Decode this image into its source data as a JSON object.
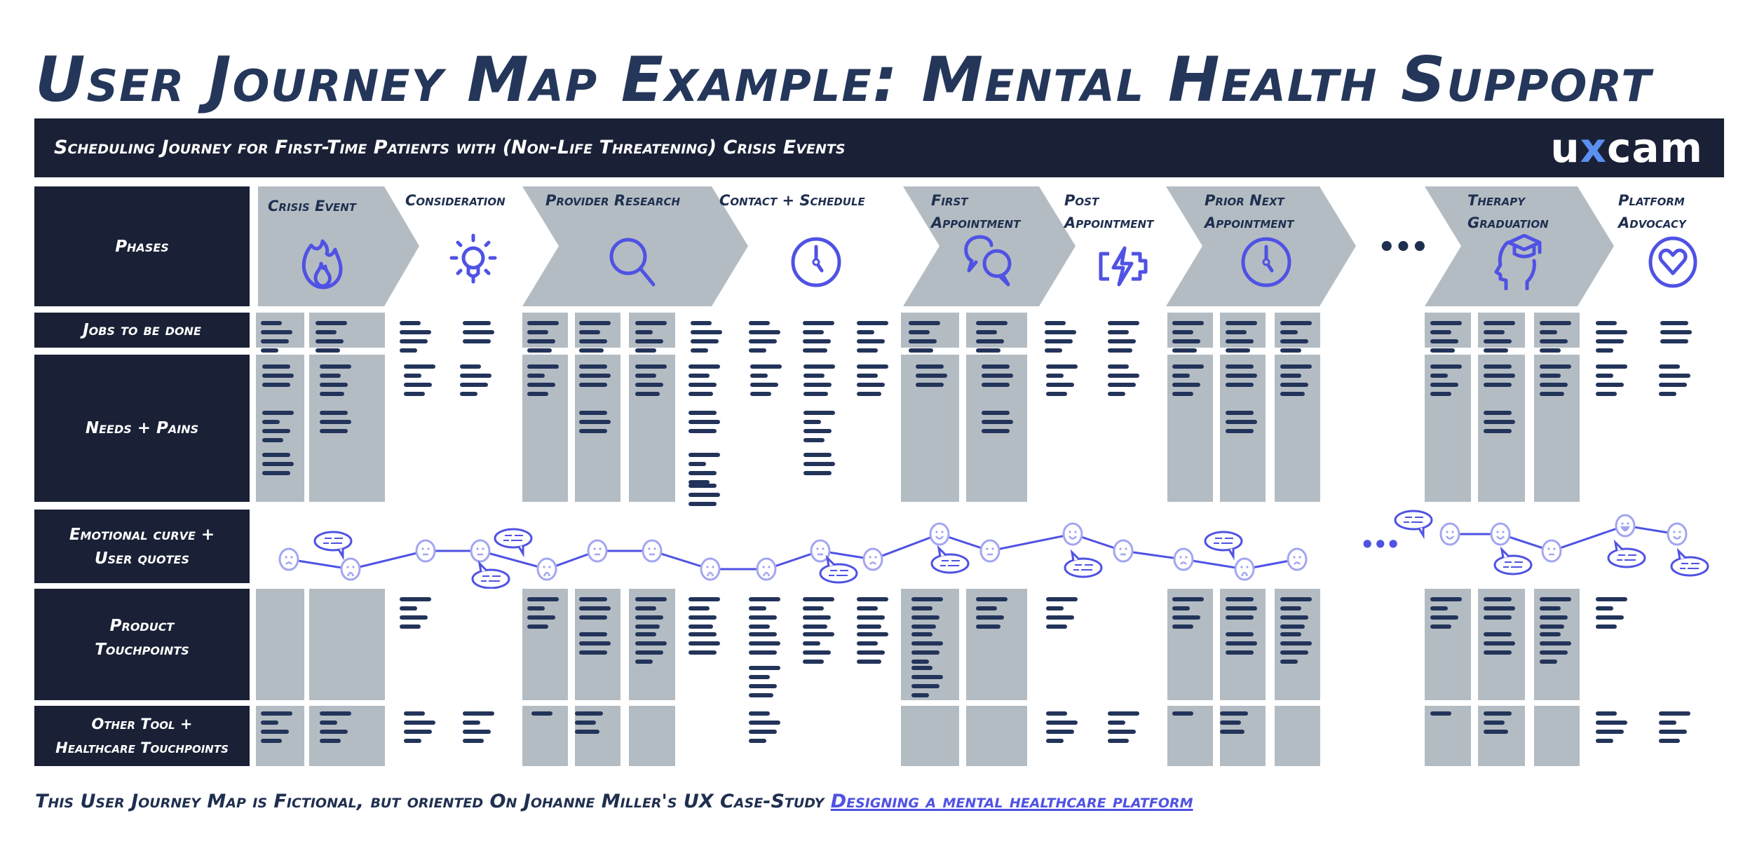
{
  "title": "User Journey Map Example: Mental Health Support",
  "banner": {
    "subtitle": "Scheduling Journey for First-Time Patients with (Non-Life Threatening) Crisis Events",
    "logo_prefix": "u",
    "logo_x": "x",
    "logo_suffix": "cam"
  },
  "row_labels": {
    "phases": "Phases",
    "jobs": "Jobs to be done",
    "needs": "Needs + Pains",
    "emotional_1": "Emotional curve +",
    "emotional_2": "User quotes",
    "product_1": "Product",
    "product_2": "Touchpoints",
    "other_1": "Other Tool +",
    "other_2": "Healthcare Touchpoints"
  },
  "phases": [
    {
      "label_1": "Crisis Event",
      "label_2": "",
      "icon": "flame-icon",
      "highlighted": true
    },
    {
      "label_1": "Consideration",
      "label_2": "",
      "icon": "lightbulb-icon",
      "highlighted": false
    },
    {
      "label_1": "Provider Research",
      "label_2": "",
      "icon": "search-icon",
      "highlighted": true
    },
    {
      "label_1": "Contact + Schedule",
      "label_2": "",
      "icon": "clock-icon",
      "highlighted": false
    },
    {
      "label_1": "First",
      "label_2": "Appointment",
      "icon": "chat-bubbles-icon",
      "highlighted": true
    },
    {
      "label_1": "Post",
      "label_2": "Appointment",
      "icon": "battery-charging-icon",
      "highlighted": false
    },
    {
      "label_1": "Prior Next",
      "label_2": "Appointment",
      "icon": "clock-icon",
      "highlighted": true
    },
    {
      "label_1": "Therapy",
      "label_2": "Graduation",
      "icon": "graduation-head-icon",
      "highlighted": true
    },
    {
      "label_1": "Platform",
      "label_2": "Advocacy",
      "icon": "heart-circle-icon",
      "highlighted": false
    }
  ],
  "ellipsis": "•••",
  "emotional_curve": {
    "segment_1": [
      "sad",
      "very-sad",
      "neutral",
      "neutral",
      "very-sad",
      "neutral",
      "neutral",
      "very-sad",
      "very-sad",
      "neutral",
      "sad",
      "happy",
      "neutral",
      "happy",
      "neutral",
      "sad",
      "very-sad",
      "sad"
    ],
    "segment_2": [
      "happy",
      "happy",
      "neutral",
      "very-happy",
      "happy"
    ]
  },
  "footer": {
    "text": "This User Journey Map is Fictional, but oriented On Johanne Miller's UX Case-Study ",
    "link": "Designing a mental healthcare platform"
  },
  "colors": {
    "navy": "#1a2035",
    "gray_cell": "#b4bcc3",
    "accent": "#4f52e3",
    "face": "#a3a6f0",
    "text": "#1f2f4f"
  }
}
